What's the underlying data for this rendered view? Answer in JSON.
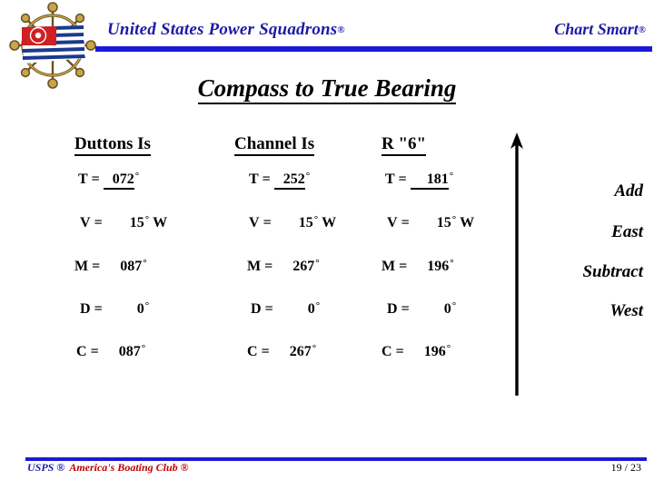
{
  "header": {
    "brand": "United States Power Squadrons",
    "brand_reg": "®",
    "product": "Chart Smart",
    "product_reg": "®",
    "rule_color": "#1a1ad6",
    "text_color": "#1a1aa8",
    "logo_icon": "ships-wheel-with-ensign-logo"
  },
  "title": "Compass to True Bearing",
  "columns": [
    {
      "header": "Duttons Is",
      "rows": [
        {
          "label": "T",
          "eq": "=",
          "value": "072",
          "deg": "°",
          "dir": "",
          "underline": true
        },
        {
          "label": "V",
          "eq": "=",
          "value": "15",
          "deg": "°",
          "dir": "W",
          "underline": false
        },
        {
          "label": "M",
          "eq": "=",
          "value": "087",
          "deg": "°",
          "dir": "",
          "underline": false
        },
        {
          "label": "D",
          "eq": "=",
          "value": "0",
          "deg": "°",
          "dir": "",
          "underline": false
        },
        {
          "label": "C",
          "eq": "=",
          "value": "087",
          "deg": "°",
          "dir": "",
          "underline": false
        }
      ]
    },
    {
      "header": "Channel Is",
      "rows": [
        {
          "label": "T",
          "eq": "=",
          "value": "252",
          "deg": "°",
          "dir": "",
          "underline": true
        },
        {
          "label": "V",
          "eq": "=",
          "value": "15",
          "deg": "°",
          "dir": "W",
          "underline": false
        },
        {
          "label": "M",
          "eq": "=",
          "value": "267",
          "deg": "°",
          "dir": "",
          "underline": false
        },
        {
          "label": "D",
          "eq": "=",
          "value": "0",
          "deg": "°",
          "dir": "",
          "underline": false
        },
        {
          "label": "C",
          "eq": "=",
          "value": "267",
          "deg": "°",
          "dir": "",
          "underline": false
        }
      ]
    },
    {
      "header": "R \"6\"",
      "rows": [
        {
          "label": "T",
          "eq": "=",
          "value": "181",
          "deg": "°",
          "dir": "",
          "underline": true
        },
        {
          "label": "V",
          "eq": "=",
          "value": "15",
          "deg": "°",
          "dir": "W",
          "underline": false
        },
        {
          "label": "M",
          "eq": "=",
          "value": "196",
          "deg": "°",
          "dir": "",
          "underline": false
        },
        {
          "label": "D",
          "eq": "=",
          "value": "0",
          "deg": "°",
          "dir": "",
          "underline": false
        },
        {
          "label": "C",
          "eq": "=",
          "value": "196",
          "deg": "°",
          "dir": "",
          "underline": false
        }
      ]
    }
  ],
  "notes": {
    "arrow_icon": "up-arrow",
    "add": "Add",
    "east": "East",
    "subtract": "Subtract",
    "west": "West"
  },
  "footer": {
    "usps": "USPS ®",
    "club": "America's Boating Club ®",
    "page": "19 / 23",
    "usps_color": "#1a1aa8",
    "club_color": "#c00000",
    "rule_color": "#1a1ad6"
  }
}
